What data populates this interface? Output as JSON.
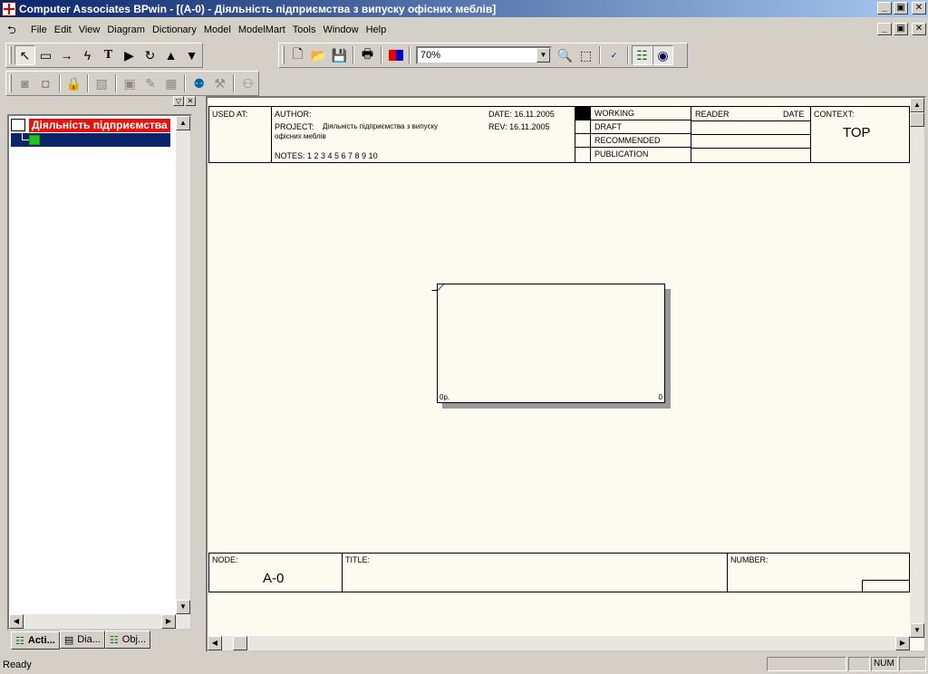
{
  "window": {
    "title": "Computer Associates BPwin - [(A-0)  - Діяльність підприємства з випуску офісних меблів]",
    "controls": [
      "_",
      "▣",
      "✕"
    ]
  },
  "menu": [
    "File",
    "Edit",
    "View",
    "Diagram",
    "Dictionary",
    "Model",
    "ModelMart",
    "Tools",
    "Window",
    "Help"
  ],
  "toolbar": {
    "drawing_tools": [
      "pointer",
      "box",
      "arrow",
      "squiggle",
      "text",
      "play",
      "rotate",
      "up",
      "down"
    ],
    "zoom_value": "70%"
  },
  "model_explorer": {
    "root_label": "Діяльність підприємства",
    "tabs": [
      {
        "label": "Acti...",
        "icon": "activity-tree-icon"
      },
      {
        "label": "Dia...",
        "icon": "diagram-icon"
      },
      {
        "label": "Obj...",
        "icon": "objects-icon"
      }
    ]
  },
  "diagram": {
    "header": {
      "used_at": "USED AT:",
      "author": "AUTHOR:",
      "project_label": "PROJECT:",
      "project_value_1": "Діяльність підприємства з випуску",
      "project_value_2": "офісних меблів",
      "notes": "NOTES:  1  2  3  4  5  6  7  8  9  10",
      "date": "DATE: 16.11.2005",
      "rev": "REV:    16.11.2005",
      "status": [
        "WORKING",
        "DRAFT",
        "RECOMMENDED",
        "PUBLICATION"
      ],
      "reader": "READER",
      "reader_date": "DATE",
      "context": "CONTEXT:",
      "context_value": "TOP"
    },
    "activity": {
      "cost": "0p.",
      "number": "0"
    },
    "footer": {
      "node": "NODE:",
      "node_value": "A-0",
      "title": "TITLE:",
      "number": "NUMBER:"
    }
  },
  "statusbar": {
    "text": "Ready",
    "num": "NUM"
  }
}
